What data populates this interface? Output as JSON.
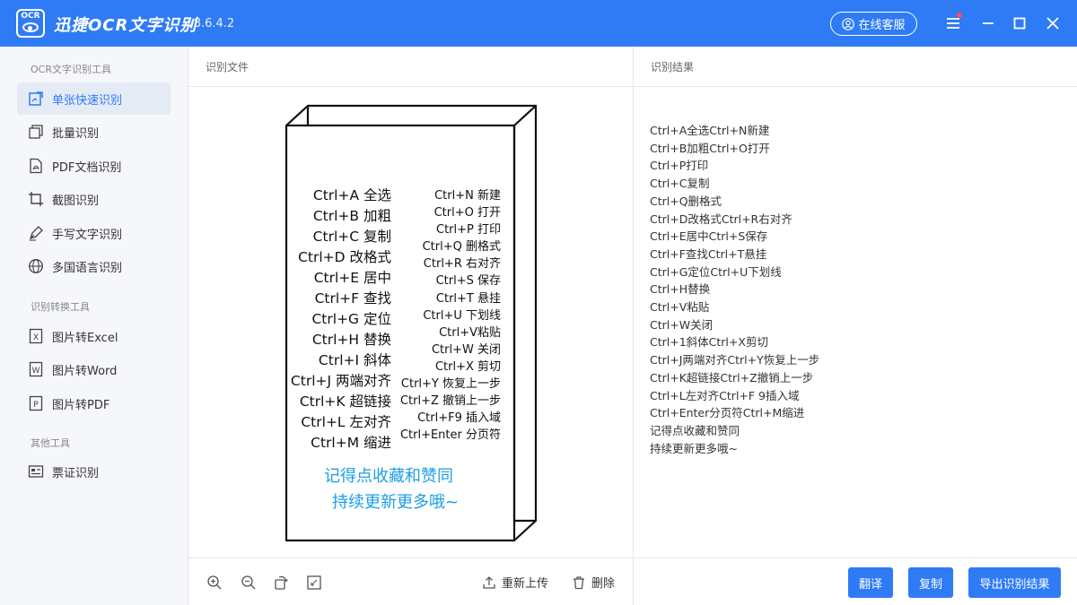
{
  "titlebar": {
    "logo_text": "OCR",
    "app_title": "迅捷OCR文字识别",
    "version": "v8.6.4.2",
    "service_label": "在线客服"
  },
  "sidebar": {
    "sections": [
      {
        "title": "OCR文字识别工具",
        "items": [
          {
            "label": "单张快速识别",
            "icon": "single-image-icon",
            "active": true
          },
          {
            "label": "批量识别",
            "icon": "batch-icon"
          },
          {
            "label": "PDF文档识别",
            "icon": "pdf-icon"
          },
          {
            "label": "截图识别",
            "icon": "crop-icon"
          },
          {
            "label": "手写文字识别",
            "icon": "pen-icon"
          },
          {
            "label": "多国语言识别",
            "icon": "globe-icon"
          }
        ]
      },
      {
        "title": "识别转换工具",
        "items": [
          {
            "label": "图片转Excel",
            "icon": "excel-icon",
            "glyph": "X"
          },
          {
            "label": "图片转Word",
            "icon": "word-icon",
            "glyph": "W"
          },
          {
            "label": "图片转PDF",
            "icon": "pdf-file-icon",
            "glyph": "P"
          }
        ]
      },
      {
        "title": "其他工具",
        "items": [
          {
            "label": "票证识别",
            "icon": "ticket-icon"
          }
        ]
      }
    ]
  },
  "middle": {
    "header": "识别文件",
    "reupload_label": "重新上传",
    "delete_label": "删除"
  },
  "book": {
    "left_lines": [
      "Ctrl+A 全选",
      "Ctrl+B 加粗",
      "Ctrl+C 复制",
      "Ctrl+D 改格式",
      "Ctrl+E 居中",
      "Ctrl+F 查找",
      "Ctrl+G 定位",
      "Ctrl+H 替换",
      "Ctrl+I 斜体",
      "Ctrl+J 两端对齐",
      "Ctrl+K 超链接",
      "Ctrl+L 左对齐",
      "Ctrl+M 缩进"
    ],
    "right_lines": [
      "Ctrl+N 新建",
      "Ctrl+O 打开",
      "Ctrl+P 打印",
      "Ctrl+Q 删格式",
      "Ctrl+R 右对齐",
      "Ctrl+S 保存",
      "Ctrl+T 悬挂",
      "Ctrl+U 下划线",
      "Ctrl+V粘贴",
      "Ctrl+W 关闭",
      "Ctrl+X 剪切",
      "Ctrl+Y 恢复上一步",
      "Ctrl+Z 撤销上一步",
      "Ctrl+F9 插入域",
      "Ctrl+Enter 分页符"
    ],
    "footer_line_1": "记得点收藏和赞同",
    "footer_line_2": "持续更新更多哦~"
  },
  "result": {
    "header": "识别结果",
    "lines": [
      "Ctrl+A全选Ctrl+N新建",
      "Ctrl+B加粗Ctrl+O打开",
      "Ctrl+P打印",
      "Ctrl+C复制",
      "Ctrl+Q删格式",
      "Ctrl+D改格式Ctrl+R右对齐",
      "Ctrl+E居中Ctrl+S保存",
      "Ctrl+F查找Ctrl+T悬挂",
      "Ctrl+G定位Ctrl+U下划线",
      "Ctrl+H替换",
      "Ctrl+V粘贴",
      "Ctrl+W关闭",
      "Ctrl+1斜体Ctrl+X剪切",
      "Ctrl+J两端对齐Ctrl+Y恢复上一步",
      "Ctrl+K超链接Ctrl+Z撤销上一步",
      "Ctrl+L左对齐Ctrl+F 9插入域",
      "Ctrl+Enter分页符Ctrl+M缩进",
      "记得点收藏和赞同",
      "持续更新更多哦~"
    ],
    "translate_label": "翻译",
    "copy_label": "复制",
    "export_label": "导出识别结果"
  },
  "colors": {
    "brand": "#2f7bf6",
    "sidebar_bg": "#f5f7fa",
    "active_bg": "#e4ebf5",
    "book_blue": "#1a9ee6",
    "notify_dot": "#ff4d4f"
  }
}
